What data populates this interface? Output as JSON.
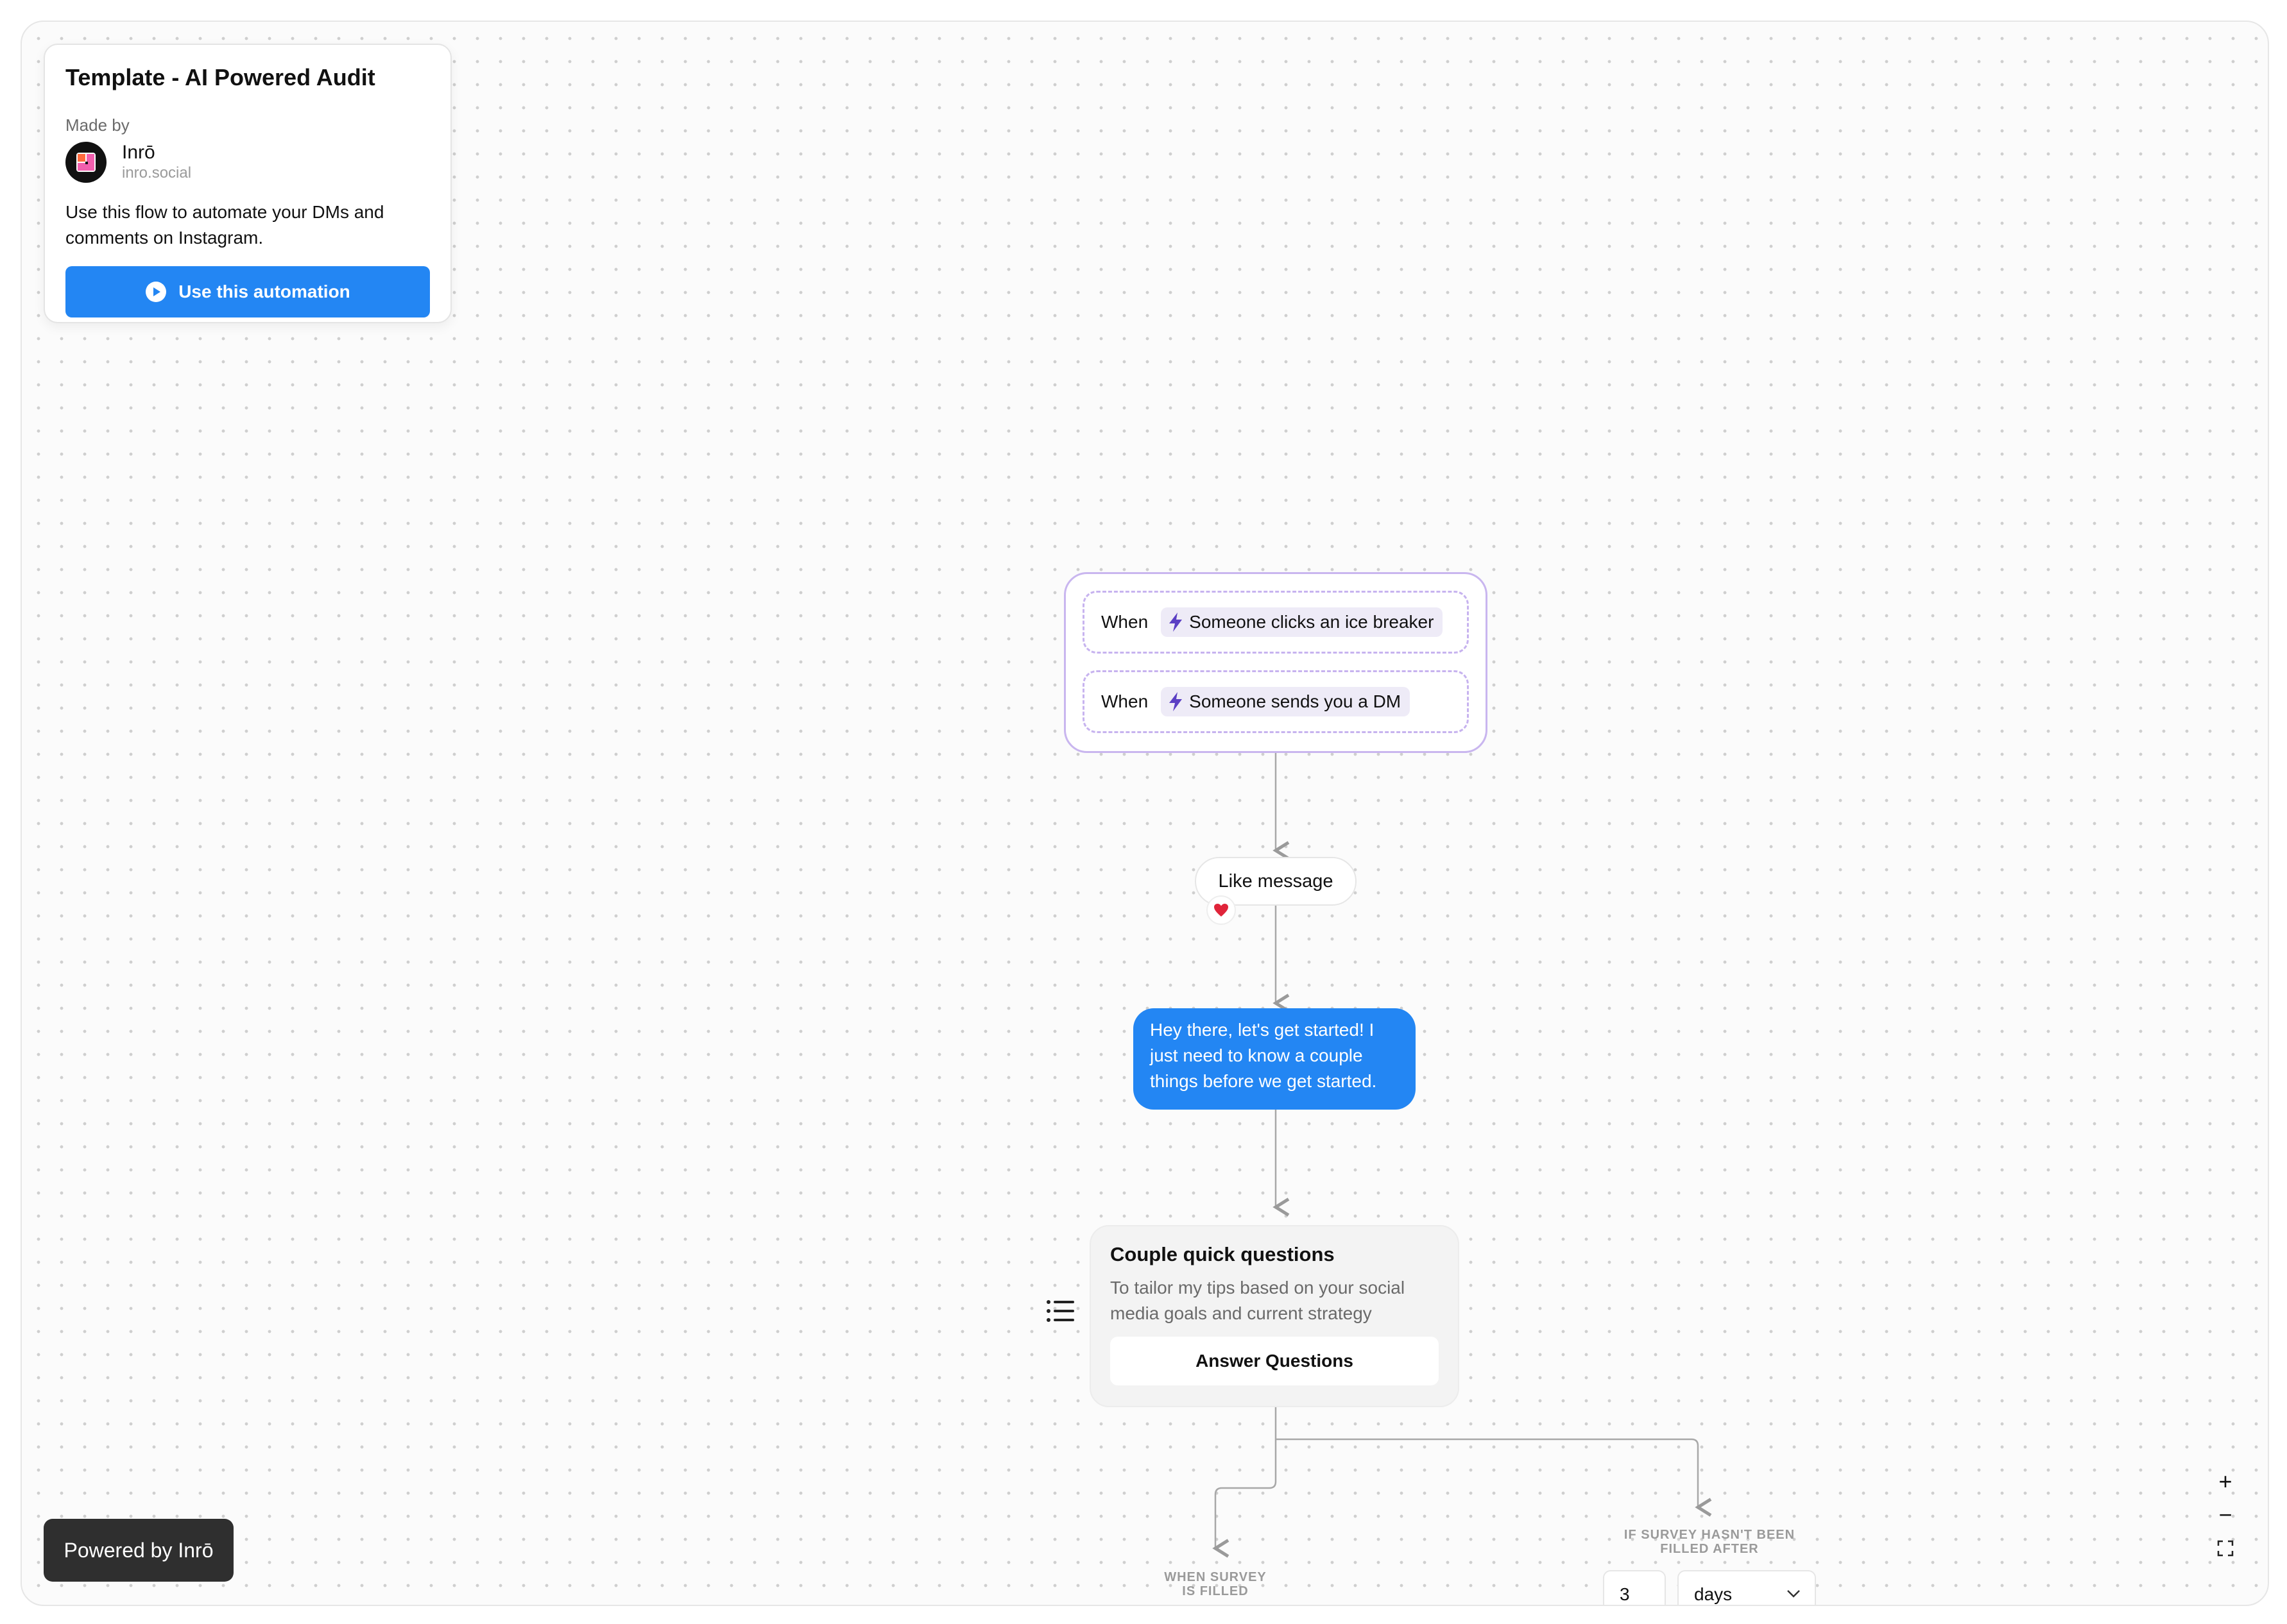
{
  "info_card": {
    "title": "Template - AI Powered Audit",
    "made_by_label": "Made by",
    "author_name": "Inrō",
    "author_site": "inro.social",
    "description": "Use this flow to automate your DMs and comments on Instagram.",
    "cta_label": "Use this automation",
    "accent_color": "#2386f3"
  },
  "flow": {
    "triggers": [
      {
        "when": "When",
        "event": "Someone clicks an ice breaker",
        "icon": "lightning-icon"
      },
      {
        "when": "When",
        "event": "Someone sends you a DM",
        "icon": "lightning-icon"
      }
    ],
    "like_action": {
      "label": "Like message",
      "icon": "heart-icon"
    },
    "message": {
      "text": "Hey there, let's get started! I just need to know a couple things before we get started."
    },
    "survey": {
      "title": "Couple quick questions",
      "description": "To tailor my tips based on your social media goals and current strategy",
      "button_label": "Answer Questions",
      "icon": "list-icon"
    },
    "branches": {
      "filled_label": "WHEN SURVEY IS FILLED",
      "not_filled_label": "IF SURVEY HASN'T BEEN FILLED AFTER",
      "delay_value": "3",
      "delay_unit": "days"
    }
  },
  "footer": {
    "powered_by": "Powered by Inrō"
  },
  "zoom_controls": {
    "zoom_in": "+",
    "zoom_out": "−",
    "fit": "fit-screen-icon"
  }
}
